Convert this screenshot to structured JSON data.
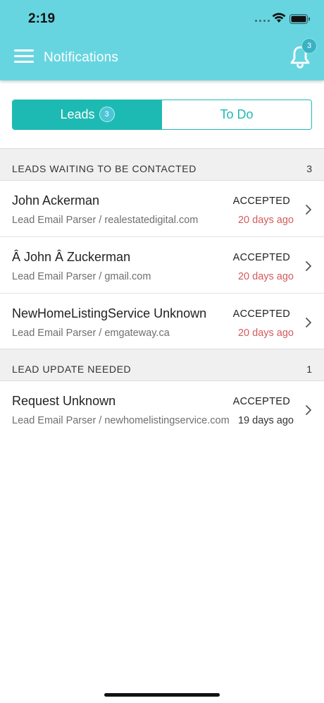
{
  "status_bar": {
    "time": "2:19"
  },
  "header": {
    "title": "Notifications",
    "notification_count": "3",
    "background_color": "#67d5e0"
  },
  "tabs": {
    "leads_label": "Leads",
    "leads_badge": "3",
    "todo_label": "To Do",
    "selected": "Leads",
    "accent_color": "#1dbab3"
  },
  "sections": [
    {
      "title": "LEADS WAITING TO BE CONTACTED",
      "count": "3",
      "rows": [
        {
          "name": "John Ackerman",
          "source": "Lead Email Parser / realestatedigital.com",
          "status": "ACCEPTED",
          "time": "20 days ago",
          "time_color": "#d35b5b"
        },
        {
          "name": "Â John Â Zuckerman",
          "source": "Lead Email Parser / gmail.com",
          "status": "ACCEPTED",
          "time": "20 days ago",
          "time_color": "#d35b5b"
        },
        {
          "name": "NewHomeListingService Unknown",
          "source": "Lead Email Parser / emgateway.ca",
          "status": "ACCEPTED",
          "time": "20 days ago",
          "time_color": "#d35b5b"
        }
      ]
    },
    {
      "title": "LEAD UPDATE NEEDED",
      "count": "1",
      "rows": [
        {
          "name": "Request Unknown",
          "source": "Lead Email Parser / newhomelistingservice.com",
          "status": "ACCEPTED",
          "time": "19 days ago",
          "time_color": "#333333"
        }
      ]
    }
  ]
}
